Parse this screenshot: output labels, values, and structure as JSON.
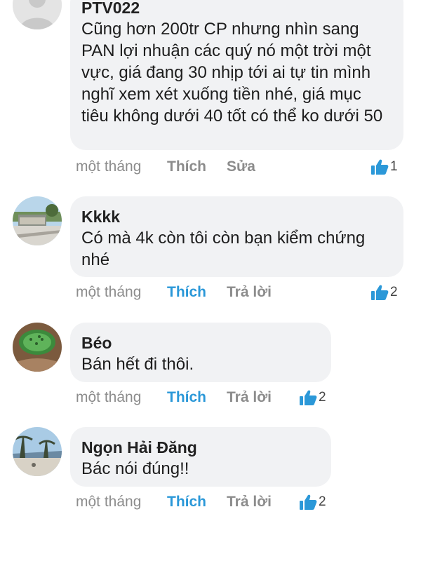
{
  "comments": [
    {
      "author": "PTV022",
      "text": "Cũng hơn 200tr CP nhưng nhìn sang PAN lợi nhuận các quý nó một trời một vực, giá đang 30 nhịp tới ai tự tin mình nghĩ xem xét xuống tiền nhé, giá mục tiêu không dưới 40 tốt có thể ko dưới 50",
      "time": "một tháng",
      "like_label": "Thích",
      "secondary_label": "Sửa",
      "like_count": "1",
      "liked": false
    },
    {
      "author": "Kkkk",
      "text": "Có mà 4k còn tôi còn bạn kiểm chứng nhé",
      "time": "một tháng",
      "like_label": "Thích",
      "secondary_label": "Trả lời",
      "like_count": "2",
      "liked": true
    },
    {
      "author": "Béo",
      "text": "Bán hết đi thôi.",
      "time": "một tháng",
      "like_label": "Thích",
      "secondary_label": "Trả lời",
      "like_count": "2",
      "liked": true
    },
    {
      "author": "Ngọn Hải Đăng",
      "text": "Bác nói đúng!!",
      "time": "một tháng",
      "like_label": "Thích",
      "secondary_label": "Trả lời",
      "like_count": "2",
      "liked": true
    }
  ],
  "colors": {
    "accent": "#2b98d8",
    "bubble": "#f1f2f4",
    "muted": "#8c8c8c"
  },
  "icons": {
    "like": "thumbs-up-icon",
    "avatar_default": "default-avatar-icon"
  }
}
